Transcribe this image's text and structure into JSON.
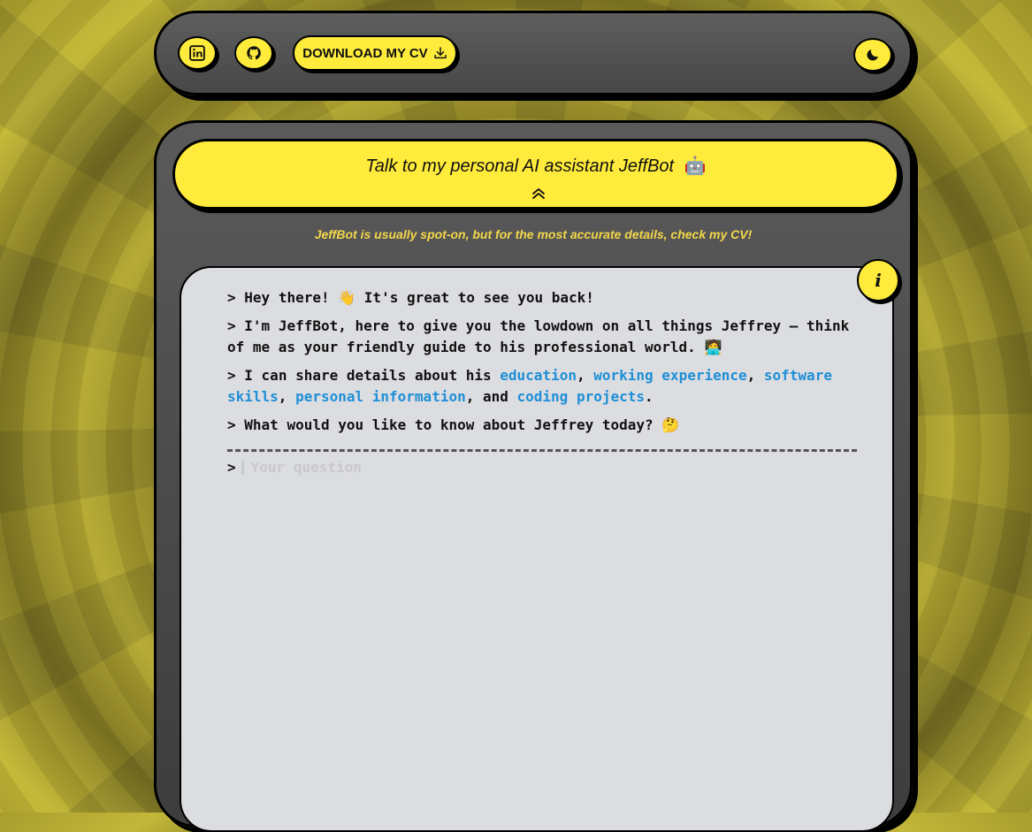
{
  "colors": {
    "accent": "#ffeb3b",
    "panel": "#4a4a4a",
    "terminal_bg": "#dcdde1",
    "link": "#1e8fd6",
    "disclaimer": "#f4d84a"
  },
  "nav": {
    "linkedin_icon": "linkedin-icon",
    "github_icon": "github-icon",
    "cv_label": "DOWNLOAD MY CV",
    "download_icon": "download-icon",
    "theme_icon": "moon-icon"
  },
  "chatbot": {
    "title": "Talk to my personal AI assistant JeffBot",
    "robot_emoji": "🤖",
    "collapse_icon": "double-chevron-up-icon",
    "disclaimer": "JeffBot is usually spot-on, but for the most accurate details, check my CV!",
    "info_label": "i"
  },
  "terminal": {
    "prefix": ">",
    "messages": {
      "m1_text": "Hey there! 👋 It's great to see you back!",
      "m2_text": "I'm JeffBot, here to give you the lowdown on all things Jeffrey — think of me as your friendly guide to his professional world. 🧑‍💻",
      "m3_intro": "I can share details about his ",
      "m3_link1": "education",
      "m3_sep1": ", ",
      "m3_link2": "working experience",
      "m3_sep2": ", ",
      "m3_link3": "software skills",
      "m3_sep3": ", ",
      "m3_link4": "personal information",
      "m3_sep4": ", and ",
      "m3_link5": "coding projects",
      "m3_end": ".",
      "m4_text": "What would you like to know about Jeffrey today? 🤔"
    },
    "input_placeholder": "Your question"
  }
}
